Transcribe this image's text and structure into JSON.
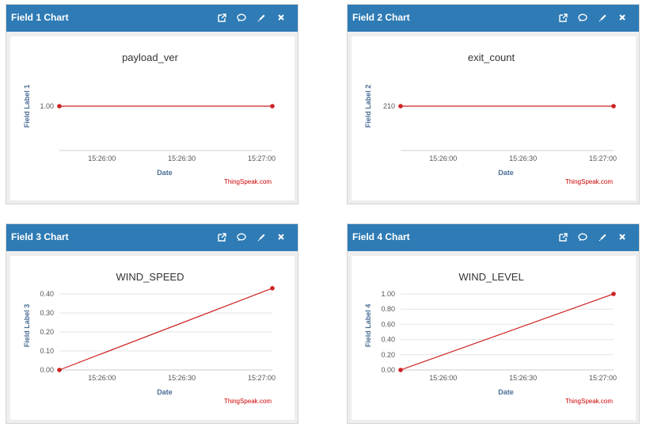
{
  "colors": {
    "header_bg": "#2e7bb5",
    "series": "#cc2222",
    "axis_label": "#4a6d95",
    "credit": "#cc0000"
  },
  "panels": [
    {
      "title": "Field 1 Chart",
      "tools": [
        "external-link-icon",
        "comment-icon",
        "pencil-icon",
        "close-icon"
      ],
      "chart_data": {
        "type": "line",
        "title": "payload_ver",
        "xlabel": "Date",
        "ylabel": "Field Label 1",
        "x_ticks": [
          "15:26:00",
          "15:26:30",
          "15:27:00"
        ],
        "y_ticks": [
          "1.00"
        ],
        "ylim": [
          0,
          1
        ],
        "points": [
          {
            "x": "15:25:44",
            "y": 1.0
          },
          {
            "x": "15:27:04",
            "y": 1.0
          }
        ],
        "credit": "ThingSpeak.com"
      }
    },
    {
      "title": "Field 2 Chart",
      "tools": [
        "external-link-icon",
        "comment-icon",
        "pencil-icon",
        "close-icon"
      ],
      "chart_data": {
        "type": "line",
        "title": "exit_count",
        "xlabel": "Date",
        "ylabel": "Field Label 2",
        "x_ticks": [
          "15:26:00",
          "15:26:30",
          "15:27:00"
        ],
        "y_ticks": [
          "210"
        ],
        "ylim": [
          0,
          1
        ],
        "points": [
          {
            "x": "15:25:44",
            "y": 210
          },
          {
            "x": "15:27:04",
            "y": 210
          }
        ],
        "credit": "ThingSpeak.com"
      }
    },
    {
      "title": "Field 3 Chart",
      "tools": [
        "external-link-icon",
        "comment-icon",
        "pencil-icon",
        "close-icon"
      ],
      "chart_data": {
        "type": "line",
        "title": "WIND_SPEED",
        "xlabel": "Date",
        "ylabel": "Field Label 3",
        "x_ticks": [
          "15:26:00",
          "15:26:30",
          "15:27:00"
        ],
        "y_ticks": [
          "0.00",
          "0.10",
          "0.20",
          "0.30",
          "0.40"
        ],
        "ylim": [
          0,
          0.4
        ],
        "points": [
          {
            "x": "15:25:44",
            "y": 0.0
          },
          {
            "x": "15:27:04",
            "y": 0.43
          }
        ],
        "credit": "ThingSpeak.com"
      }
    },
    {
      "title": "Field 4 Chart",
      "tools": [
        "external-link-icon",
        "comment-icon",
        "pencil-icon",
        "close-icon"
      ],
      "chart_data": {
        "type": "line",
        "title": "WIND_LEVEL",
        "xlabel": "Date",
        "ylabel": "Field Label 4",
        "x_ticks": [
          "15:26:00",
          "15:26:30",
          "15:27:00"
        ],
        "y_ticks": [
          "0.00",
          "0.20",
          "0.40",
          "0.60",
          "0.80",
          "1.00"
        ],
        "ylim": [
          0,
          1
        ],
        "points": [
          {
            "x": "15:25:44",
            "y": 0.0
          },
          {
            "x": "15:27:04",
            "y": 1.0
          }
        ],
        "credit": "ThingSpeak.com"
      }
    }
  ]
}
